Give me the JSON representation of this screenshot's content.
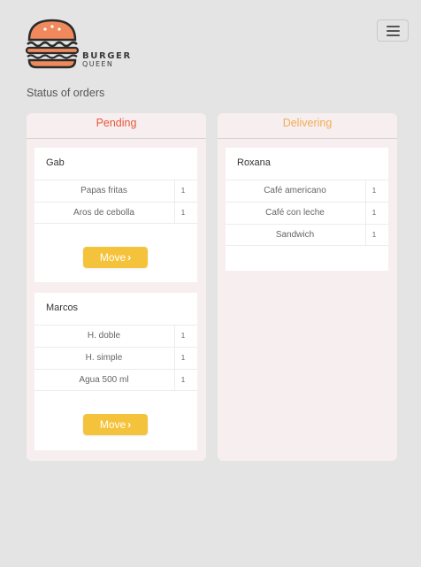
{
  "header": {
    "brand_line1": "BURGER",
    "brand_line2": "QUEEN",
    "menu_icon": "hamburger-menu-icon",
    "logo_colors": {
      "bun": "#f08a5d",
      "dark": "#2b2b2b"
    }
  },
  "page": {
    "title": "Status of orders"
  },
  "colors": {
    "pending": "#e8573d",
    "delivering": "#f2aa56",
    "button": "#f5c33b"
  },
  "columns": [
    {
      "title": "Pending",
      "orders": [
        {
          "customer": "Gab",
          "items": [
            {
              "name": "Papas fritas",
              "qty": "1"
            },
            {
              "name": "Aros de cebolla",
              "qty": "1"
            }
          ],
          "action_label": "Move",
          "action_icon": "chevron-right-icon"
        },
        {
          "customer": "Marcos",
          "items": [
            {
              "name": "H. doble",
              "qty": "1"
            },
            {
              "name": "H. simple",
              "qty": "1"
            },
            {
              "name": "Agua 500 ml",
              "qty": "1"
            }
          ],
          "action_label": "Move",
          "action_icon": "chevron-right-icon"
        }
      ]
    },
    {
      "title": "Delivering",
      "orders": [
        {
          "customer": "Roxana",
          "items": [
            {
              "name": "Café americano",
              "qty": "1"
            },
            {
              "name": "Café con leche",
              "qty": "1"
            },
            {
              "name": "Sandwich",
              "qty": "1"
            }
          ]
        }
      ]
    }
  ]
}
